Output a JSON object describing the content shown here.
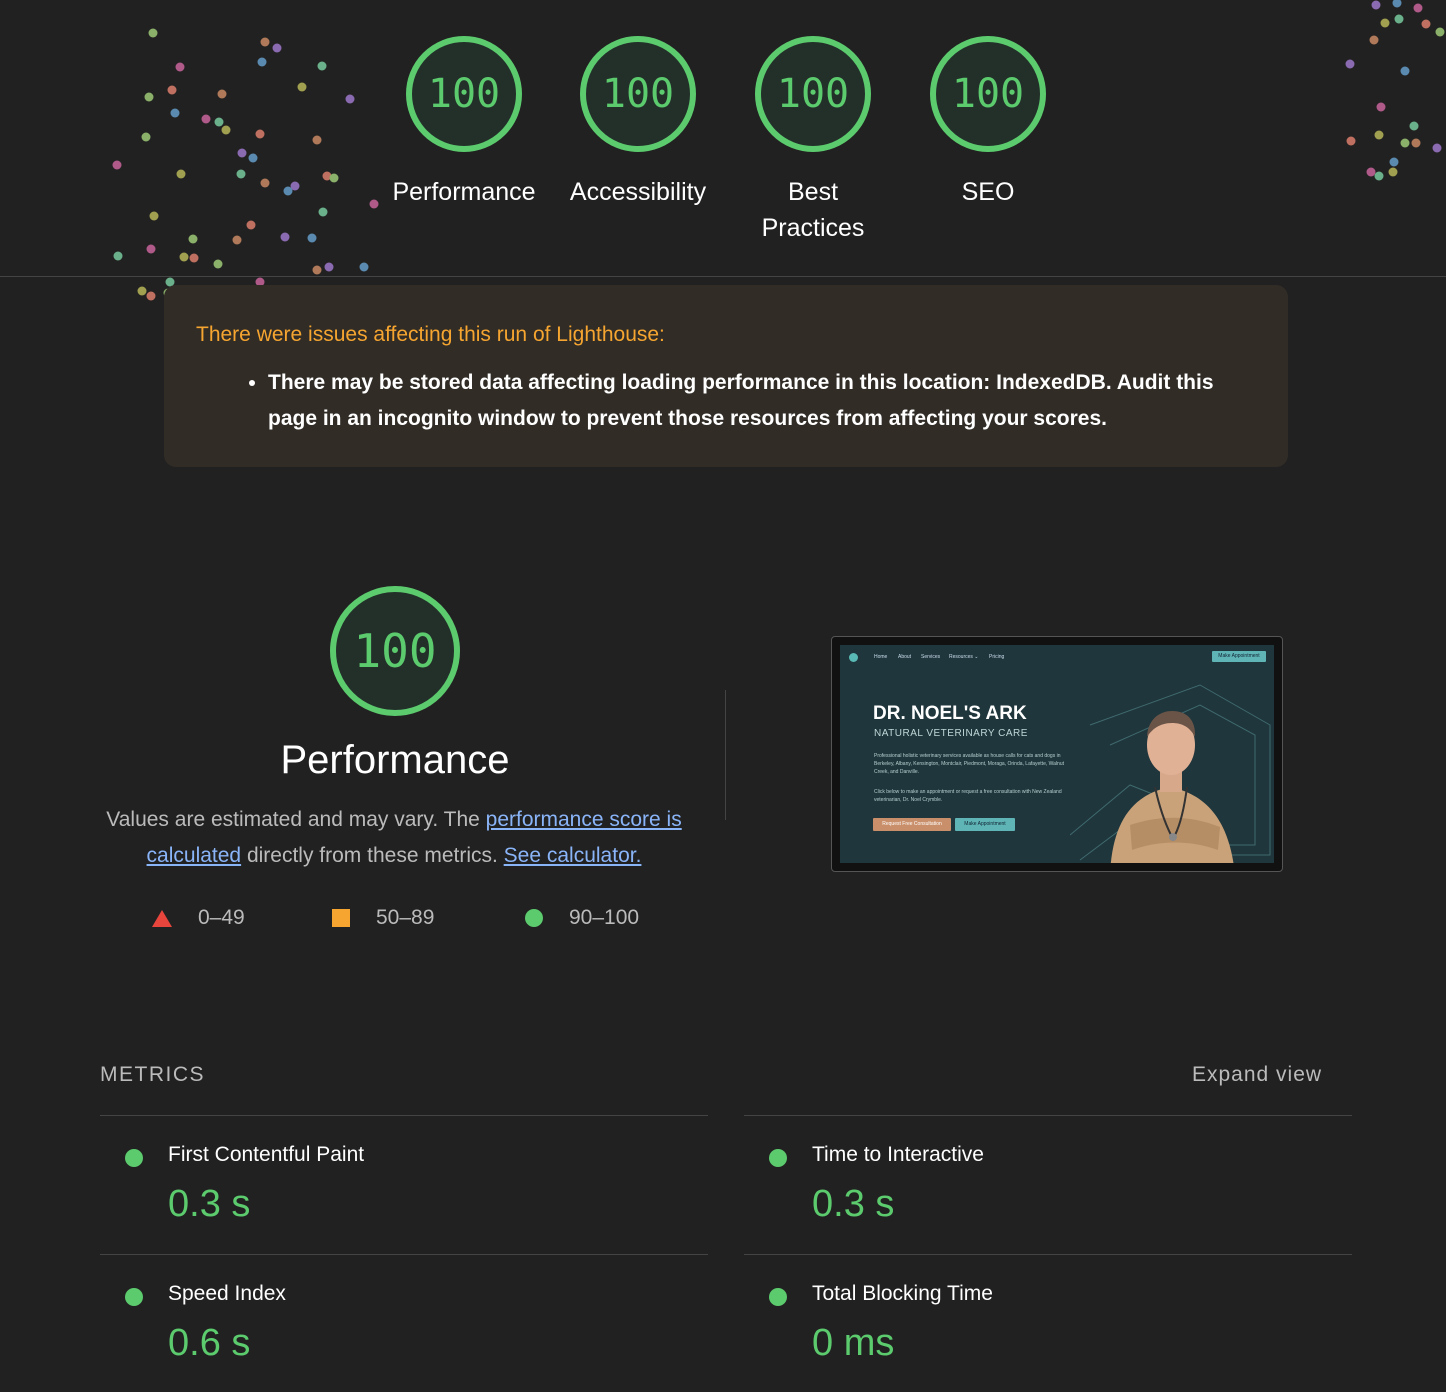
{
  "scores": [
    {
      "value": "100",
      "label": "Performance"
    },
    {
      "value": "100",
      "label": "Accessibility"
    },
    {
      "value": "100",
      "label": "Best Practices"
    },
    {
      "value": "100",
      "label": "SEO"
    }
  ],
  "warning": {
    "title": "There were issues affecting this run of Lighthouse:",
    "item": "There may be stored data affecting loading performance in this location: IndexedDB. Audit this page in an incognito window to prevent those resources from affecting your scores."
  },
  "performance": {
    "score": "100",
    "title": "Performance",
    "desc_prefix": "Values are estimated and may vary. The ",
    "desc_link1": "performance score is calculated",
    "desc_middle": " directly from these metrics. ",
    "desc_link2": "See calculator."
  },
  "legend": {
    "fail": "0–49",
    "average": "50–89",
    "pass": "90–100"
  },
  "colors": {
    "pass": "#5ccb6e",
    "average": "#f5a530",
    "fail": "#e8453c",
    "link": "#8ab4f8"
  },
  "screenshot": {
    "nav": [
      "Home",
      "About",
      "Services",
      "Resources ⌄",
      "Pricing"
    ],
    "button": "Make Appointment",
    "title": "DR. NOEL'S ARK",
    "subtitle": "NATURAL VETERINARY CARE",
    "text1": "Professional holistic veterinary services available as house calls for cats and dogs in Berkeley, Albany, Kensington, Montclair, Piedmont, Moraga, Orinda, Lafayette, Walnut Creek, and Danville.",
    "text2": "Click below to make an appointment or request a free consultation with New Zealand veterinarian, Dr. Noel Crymble.",
    "cta1": "Request Free Consultation",
    "cta2": "Make Appointment"
  },
  "metrics": {
    "heading": "METRICS",
    "expand": "Expand view",
    "items": [
      {
        "label": "First Contentful Paint",
        "value": "0.3 s"
      },
      {
        "label": "Time to Interactive",
        "value": "0.3 s"
      },
      {
        "label": "Speed Index",
        "value": "0.6 s"
      },
      {
        "label": "Total Blocking Time",
        "value": "0 ms"
      }
    ]
  }
}
